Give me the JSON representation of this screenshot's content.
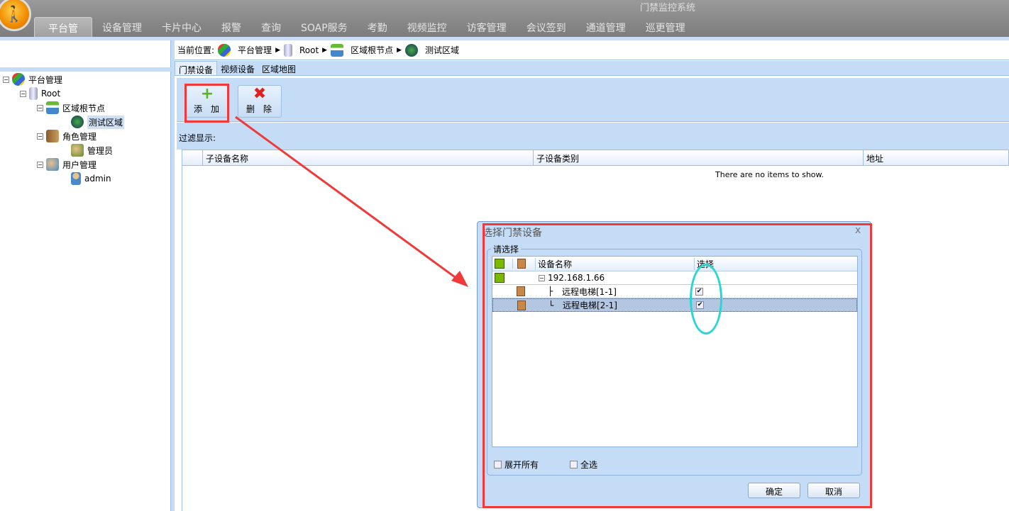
{
  "app": {
    "title": "门禁监控系统"
  },
  "nav_tabs": [
    "平台管理",
    "设备管理",
    "卡片中心",
    "报警",
    "查询",
    "SOAP服务",
    "考勤",
    "视频监控",
    "访客管理",
    "会议签到",
    "通道管理",
    "巡更管理"
  ],
  "tree": [
    {
      "label": "平台管理",
      "level": 0,
      "icon": "shield-icon"
    },
    {
      "label": "Root",
      "level": 1,
      "icon": "server-icon"
    },
    {
      "label": "区域根节点",
      "level": 2,
      "icon": "network-icon"
    },
    {
      "label": "测试区域",
      "level": 3,
      "icon": "globe-icon",
      "selected": true
    },
    {
      "label": "角色管理",
      "level": 2,
      "icon": "roles-icon"
    },
    {
      "label": "管理员",
      "level": 3,
      "icon": "users-icon"
    },
    {
      "label": "用户管理",
      "level": 2,
      "icon": "user-group-icon"
    },
    {
      "label": "admin",
      "level": 3,
      "icon": "user-icon"
    }
  ],
  "breadcrumb": {
    "prefix": "当前位置:",
    "items": [
      "平台管理",
      "Root",
      "区域根节点",
      "测试区域"
    ]
  },
  "sub_tabs": [
    "门禁设备",
    "视频设备",
    "区域地图"
  ],
  "toolbar": {
    "add": "添加",
    "delete": "删除"
  },
  "filter_label": "过滤显示:",
  "table": {
    "columns": [
      "子设备名称",
      "子设备类别",
      "地址"
    ],
    "empty": "There are no items to show."
  },
  "dialog": {
    "title": "选择门禁设备",
    "close": "x",
    "group": "请选择",
    "columns": [
      "设备名称",
      "选择"
    ],
    "rows": [
      {
        "name": "192.168.1.66",
        "type": "controller"
      },
      {
        "name": "远程电梯[1-1]",
        "type": "door",
        "checked": true
      },
      {
        "name": "远程电梯[2-1]",
        "type": "door",
        "checked": true,
        "selected": true
      }
    ],
    "expand_all": "展开所有",
    "select_all": "全选",
    "ok": "确定",
    "cancel": "取消"
  }
}
